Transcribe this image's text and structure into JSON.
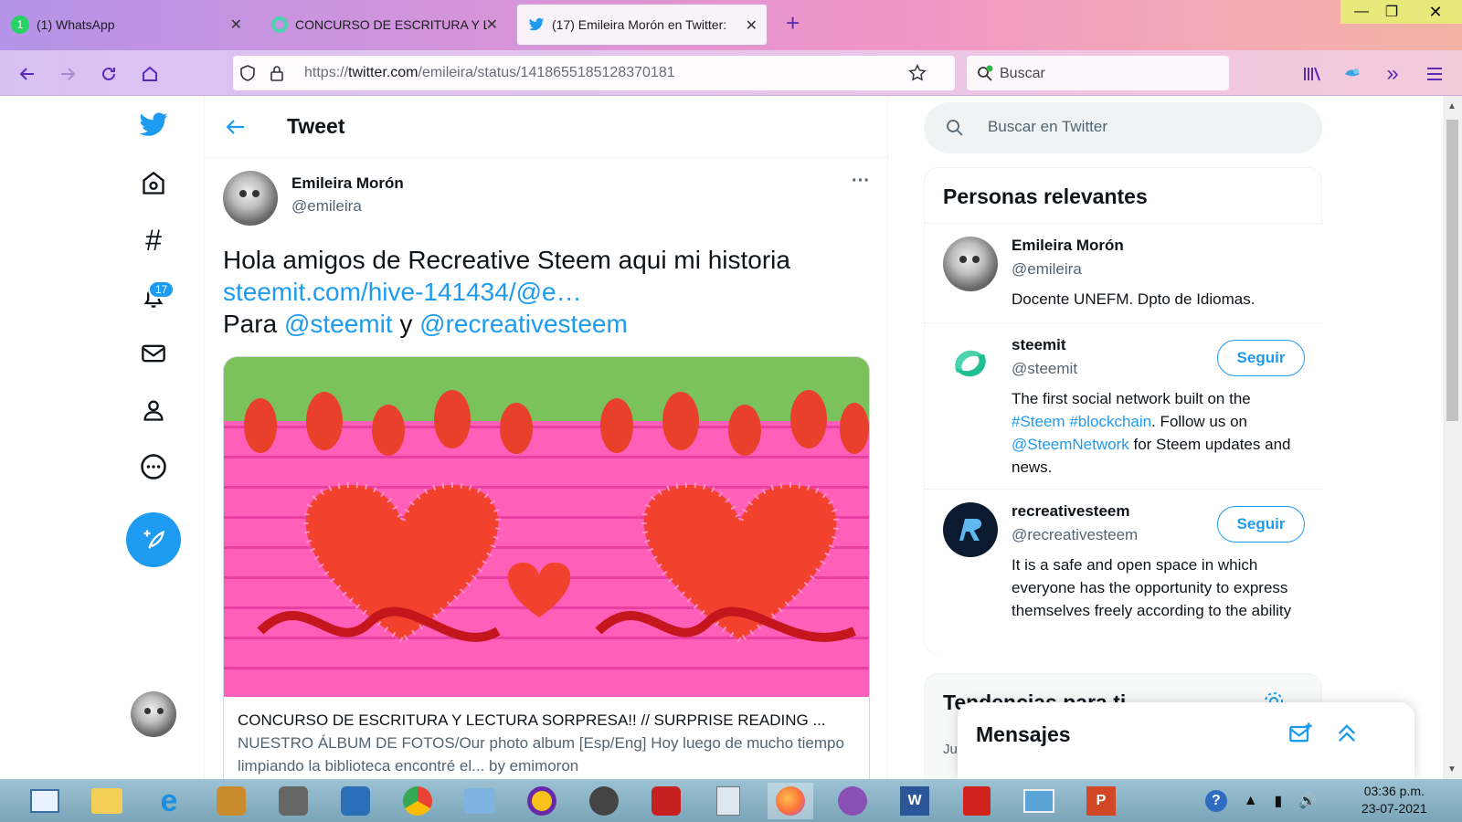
{
  "browser": {
    "tabs": [
      {
        "label": "(1) WhatsApp",
        "icon": "whatsapp-icon"
      },
      {
        "label": "CONCURSO DE ESCRITURA Y LE",
        "icon": "steemit-icon"
      },
      {
        "label": "(17) Emileira Morón en Twitter:",
        "icon": "twitter-icon"
      }
    ],
    "new_tab": "+",
    "url_prefix": "https://",
    "url_domain": "twitter.com",
    "url_path": "/emileira/status/1418655185128370181",
    "search_placeholder": "Buscar"
  },
  "twitter": {
    "notif_badge": "17",
    "header_title": "Tweet",
    "tweet": {
      "name": "Emileira Morón",
      "handle": "@emileira",
      "more": "···",
      "text1": "Hola amigos de Recreative Steem aqui mi historia",
      "link": "steemit.com/hive-141434/@e…",
      "para": "Para",
      "mention1": "@steemit",
      "y": "y",
      "mention2": "@recreativesteem",
      "card_title": "CONCURSO DE ESCRITURA Y LECTURA SORPRESA!! // SURPRISE READING ...",
      "card_desc": "NUESTRO ÁLBUM DE FOTOS/Our photo album [Esp/Eng] Hoy luego de mucho tiempo limpiando la biblioteca encontré el... by emimoron"
    },
    "search_placeholder": "Buscar en Twitter",
    "relevant": {
      "title": "Personas relevantes",
      "people": [
        {
          "name": "Emileira Morón",
          "handle": "@emileira",
          "bio": "Docente UNEFM. Dpto de Idiomas."
        },
        {
          "name": "steemit",
          "handle": "@steemit",
          "bio_pre": "The first social network built on the ",
          "tag1": "#Steem",
          "sp": " ",
          "tag2": "#blockchain",
          "bio_mid": ". Follow us on ",
          "tag3": "@SteemNetwork",
          "bio_post": " for Steem updates and news.",
          "button": "Seguir"
        },
        {
          "name": "recreativesteem",
          "handle": "@recreativesteem",
          "bio": "It is a safe and open space in which everyone has the opportunity to express themselves freely according to the ability",
          "button": "Seguir"
        }
      ]
    },
    "trends_title": "Tendencias para ti",
    "trends_sub": "Ju",
    "messages": "Mensajes"
  },
  "taskbar": {
    "time": "03:36 p.m.",
    "date": "23-07-2021"
  },
  "colors": {
    "twitter_blue": "#1d9bf0",
    "text": "#0f1419",
    "muted": "#536471"
  }
}
